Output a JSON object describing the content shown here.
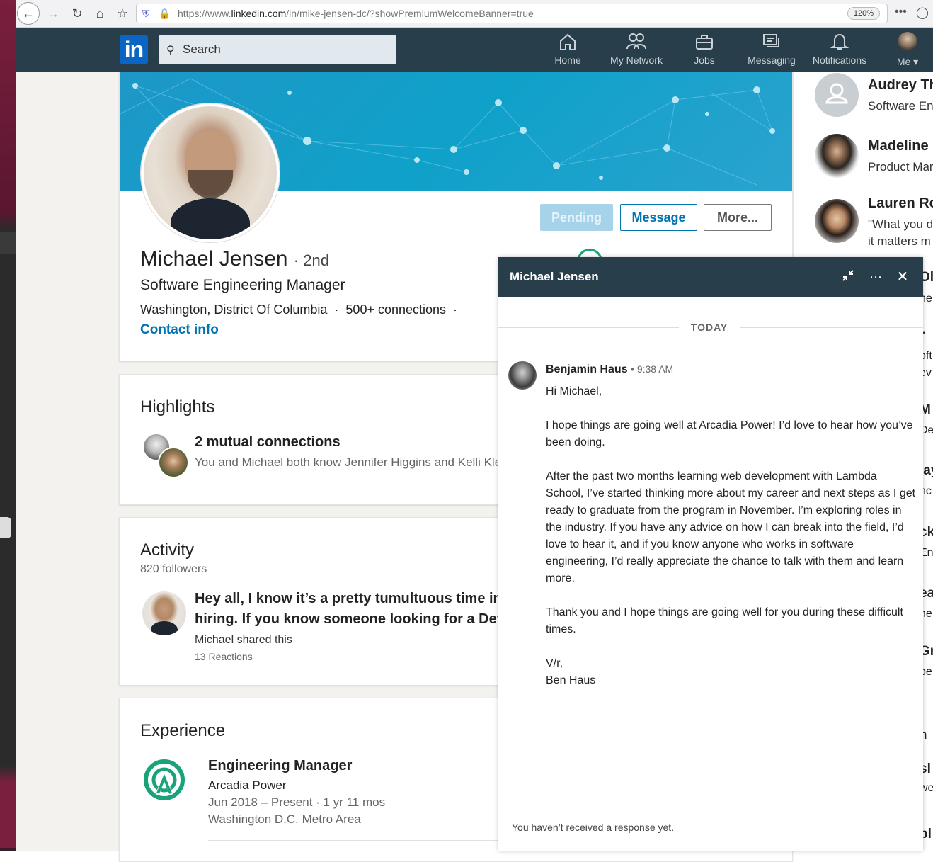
{
  "browser": {
    "url_prefix": "https://www.",
    "url_domain": "linkedin.com",
    "url_path": "/in/mike-jensen-dc/?showPremiumWelcomeBanner=true",
    "zoom": "120%",
    "menu_glyph": "•••"
  },
  "nav": {
    "logo": "in",
    "search_placeholder": "Search",
    "items": [
      {
        "label": "Home"
      },
      {
        "label": "My Network"
      },
      {
        "label": "Jobs"
      },
      {
        "label": "Messaging"
      },
      {
        "label": "Notifications"
      },
      {
        "label": "Me"
      }
    ]
  },
  "profile": {
    "name": "Michael Jensen",
    "degree": "2nd",
    "headline": "Software Engineering Manager",
    "location": "Washington, District Of Columbia",
    "connections": "500+ connections",
    "contact": "Contact info",
    "actions": {
      "pending": "Pending",
      "message": "Message",
      "more": "More..."
    }
  },
  "highlights": {
    "title": "Highlights",
    "mutual_title": "2 mutual connections",
    "mutual_sub": "You and Michael both know Jennifer Higgins and Kelli Kle"
  },
  "activity": {
    "title": "Activity",
    "followers": "820 followers",
    "post_line1": "Hey all, I know it’s a pretty tumultuous time in t",
    "post_line2": "hiring. If you know someone looking for a DevO",
    "shared": "Michael shared this",
    "reactions": "13 Reactions"
  },
  "experience": {
    "title": "Experience",
    "role": "Engineering Manager",
    "company": "Arcadia Power",
    "dates": "Jun 2018 – Present · 1 yr 11 mos",
    "location": "Washington D.C. Metro Area"
  },
  "right_rail": {
    "people": [
      {
        "name": "Audrey Th",
        "sub1": "Software En",
        "sub2": ""
      },
      {
        "name": "Madeline I",
        "sub1": "Product Mar",
        "sub2": ""
      },
      {
        "name": "Lauren Ro",
        "sub1": "\"What you d",
        "sub2": "it matters m"
      }
    ],
    "peeks": [
      "Ol",
      "ne",
      "r",
      "oft",
      "ev",
      "M",
      "De",
      "lay",
      "nc",
      "ck",
      "En",
      "ea",
      "ne",
      "Gr",
      "pe",
      "h",
      "sl",
      "we",
      "pl"
    ]
  },
  "message": {
    "title": "Michael Jensen",
    "day_label": "TODAY",
    "sender": "Benjamin Haus",
    "time": "• 9:38 AM",
    "greeting": "Hi Michael,",
    "p1": "I hope things are going well at Arcadia Power! I’d love to hear how you’ve been doing.",
    "p2": "After the past two months learning web development with Lambda School, I’ve started thinking more about my career and next steps as I get ready to graduate from the program in November. I’m exploring roles in the industry. If you have any advice on how I can break into the field, I’d love to hear it, and if you know anyone who works in software engineering, I’d really appreciate the chance to talk with them and learn more.",
    "p3": "Thank you and I hope things are going well for you during these difficult times.",
    "sign1": "V/r,",
    "sign2": "Ben Haus",
    "footer": "You haven’t received a response yet."
  },
  "colors": {
    "nav_bg": "#283e4a",
    "brand": "#0073b1",
    "pending": "#a6d3ea"
  }
}
